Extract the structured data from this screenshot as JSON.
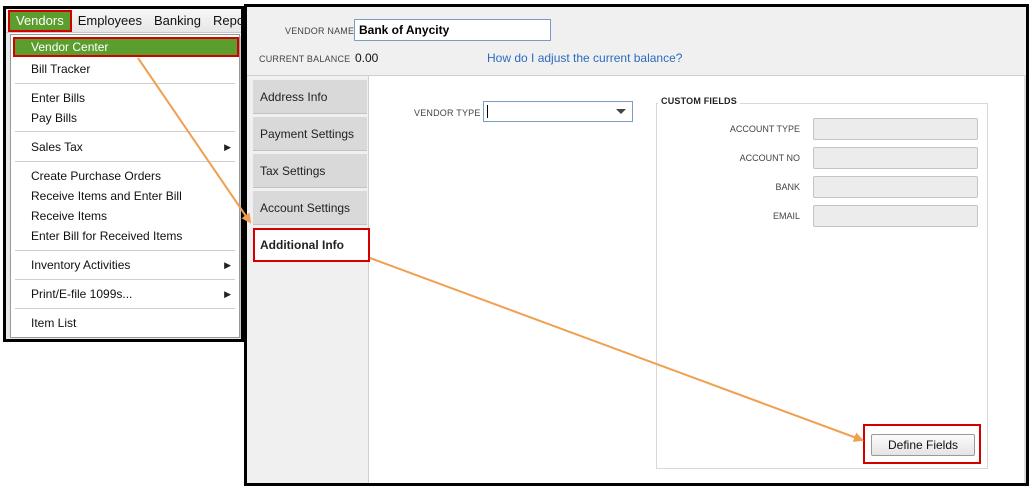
{
  "menubar": {
    "items": [
      "Vendors",
      "Employees",
      "Banking",
      "Reports"
    ],
    "active_index": 0
  },
  "vendors_menu": {
    "groups": [
      [
        "Vendor Center",
        "Bill Tracker"
      ],
      [
        "Enter Bills",
        "Pay Bills"
      ],
      [
        "Sales Tax"
      ],
      [
        "Create Purchase Orders",
        "Receive Items and Enter Bill",
        "Receive Items",
        "Enter Bill for Received Items"
      ],
      [
        "Inventory Activities"
      ],
      [
        "Print/E-file 1099s..."
      ],
      [
        "Item List"
      ]
    ],
    "highlighted": "Vendor Center",
    "submenu_items": [
      "Sales Tax",
      "Inventory Activities",
      "Print/E-file 1099s..."
    ],
    "submenu_arrow_icon": "triangle-right-icon"
  },
  "vendor_dialog": {
    "vendor_name_label": "VENDOR NAME",
    "vendor_name_value": "Bank of Anycity",
    "current_balance_label": "CURRENT BALANCE",
    "current_balance_value": "0.00",
    "adjust_balance_link": "How do I adjust the current balance?",
    "tabs": [
      "Address Info",
      "Payment Settings",
      "Tax Settings",
      "Account Settings",
      "Additional Info"
    ],
    "active_tab": "Additional Info",
    "vendor_type_label": "VENDOR TYPE",
    "vendor_type_value": "",
    "custom_fields": {
      "title": "CUSTOM FIELDS",
      "fields": [
        {
          "label": "ACCOUNT TYPE",
          "value": ""
        },
        {
          "label": "ACCOUNT NO",
          "value": ""
        },
        {
          "label": "BANK",
          "value": ""
        },
        {
          "label": "EMAIL",
          "value": ""
        }
      ],
      "define_button_label": "Define Fields"
    }
  },
  "colors": {
    "menu_highlight": "#5c9e2e",
    "annotation_box": "#d40000",
    "annotation_arrow": "#f0a050",
    "link": "#2a6cbf"
  }
}
